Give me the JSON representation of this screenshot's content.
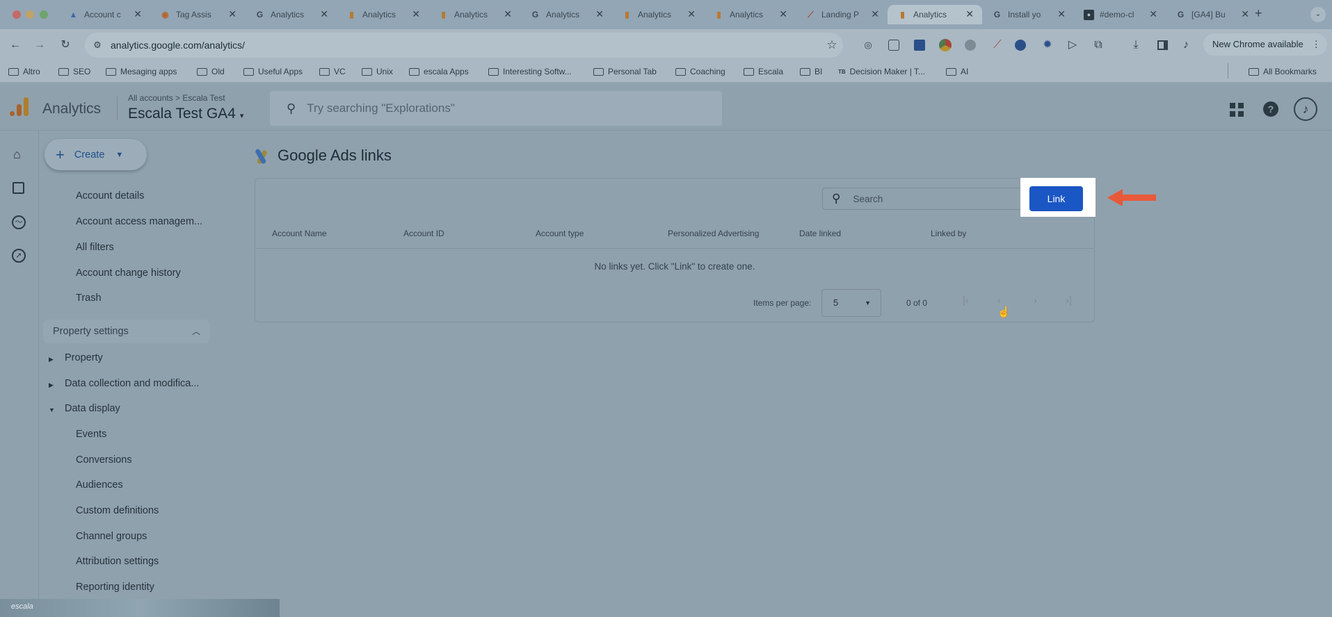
{
  "browser": {
    "tabs": [
      {
        "title": "Account c",
        "icon": "google-ads-icon"
      },
      {
        "title": "Tag Assis",
        "icon": "tag-assistant-icon"
      },
      {
        "title": "Analytics",
        "icon": "google-g-icon"
      },
      {
        "title": "Analytics",
        "icon": "analytics-icon"
      },
      {
        "title": "Analytics",
        "icon": "analytics-icon"
      },
      {
        "title": "Analytics",
        "icon": "google-g-icon"
      },
      {
        "title": "Analytics",
        "icon": "analytics-icon"
      },
      {
        "title": "Analytics",
        "icon": "analytics-icon"
      },
      {
        "title": "Landing P",
        "icon": "landing-page-icon"
      },
      {
        "title": "Analytics",
        "icon": "analytics-icon"
      },
      {
        "title": "Install yo",
        "icon": "google-g-icon"
      },
      {
        "title": "#demo-cl",
        "icon": "github-icon"
      },
      {
        "title": "[GA4] Bu",
        "icon": "google-g-icon"
      }
    ],
    "new_tab": "+",
    "url": "analytics.google.com/analytics/",
    "chrome_update": "New Chrome available",
    "bookmarks": [
      "Altro",
      "SEO",
      "Mesaging apps",
      "Old",
      "Useful Apps",
      "VC",
      "Unix",
      "escala Apps",
      "Interesting Softw...",
      "Personal Tab",
      "Coaching",
      "Escala",
      "BI",
      "Decision Maker | T...",
      "AI"
    ],
    "all_bookmarks": "All Bookmarks"
  },
  "app": {
    "name": "Analytics",
    "breadcrumb_root": "All accounts",
    "breadcrumb_sep": ">",
    "breadcrumb_account": "Escala Test",
    "property": "Escala Test GA4",
    "search_placeholder": "Try searching \"Explorations\""
  },
  "sidebar": {
    "create": "Create",
    "account_items": [
      "Account details",
      "Account access managem...",
      "All filters",
      "Account change history",
      "Trash"
    ],
    "section": "Property settings",
    "groups": [
      "Property",
      "Data collection and modifica...",
      "Data display"
    ],
    "display_items": [
      "Events",
      "Conversions",
      "Audiences",
      "Custom definitions",
      "Channel groups",
      "Attribution settings",
      "Reporting identity"
    ]
  },
  "main": {
    "title": "Google Ads links",
    "search_placeholder": "Search",
    "link_button": "Link",
    "columns": [
      "Account Name",
      "Account ID",
      "Account type",
      "Personalized Advertising",
      "Date linked",
      "Linked by"
    ],
    "empty": "No links yet. Click \"Link\" to create one.",
    "items_per_page_label": "Items per page:",
    "items_per_page": "5",
    "range": "0 of 0"
  },
  "overlay": {
    "thumb_label": "escala"
  },
  "colors": {
    "accent": "#1a56c4",
    "callout": "#e8593a",
    "dim_bg": "#8fa1ad"
  }
}
